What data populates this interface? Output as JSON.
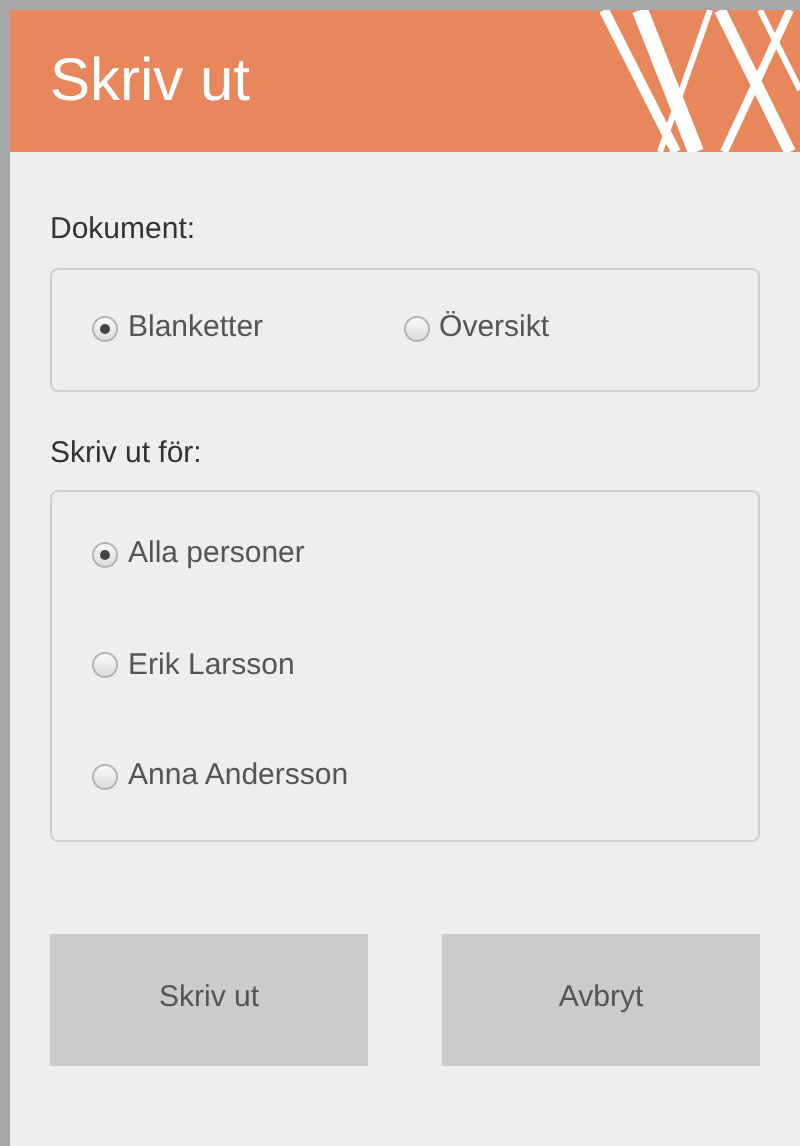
{
  "dialog": {
    "title": "Skriv ut"
  },
  "groups": [
    {
      "label": "Dokument:",
      "kind": "inline",
      "options": [
        {
          "label": "Blanketter",
          "selected": true
        },
        {
          "label": "Översikt",
          "selected": false
        }
      ]
    },
    {
      "label": "Skriv ut för:",
      "kind": "stacked",
      "options": [
        {
          "label": "Alla personer",
          "selected": true
        },
        {
          "label": "Erik Larsson",
          "selected": false
        },
        {
          "label": "Anna Andersson",
          "selected": false
        }
      ]
    }
  ],
  "buttons": [
    "Skriv ut",
    "Avbryt"
  ]
}
